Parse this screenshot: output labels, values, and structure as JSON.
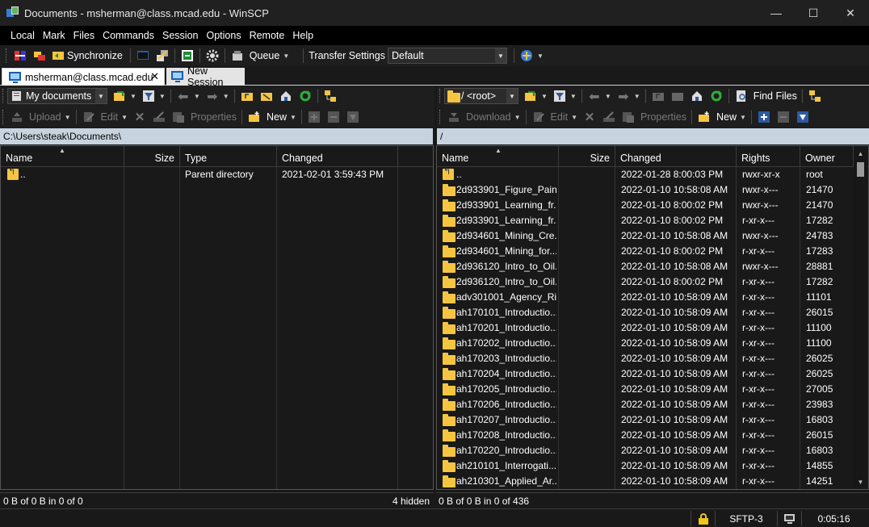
{
  "window": {
    "title": "Documents - msherman@class.mcad.edu - WinSCP",
    "controls": [
      "—",
      "☐",
      "✕"
    ]
  },
  "menu": [
    "Local",
    "Mark",
    "Files",
    "Commands",
    "Session",
    "Options",
    "Remote",
    "Help"
  ],
  "toolbar": {
    "synchronize": "Synchronize",
    "queue": "Queue",
    "transfer_settings": "Transfer Settings",
    "transfer_profile": "Default"
  },
  "tabs": {
    "active": "msherman@class.mcad.edu",
    "new_session": "New Session"
  },
  "local": {
    "location": "My documents",
    "upload": "Upload",
    "edit": "Edit",
    "properties": "Properties",
    "new": "New",
    "path": "C:\\Users\\steak\\Documents\\",
    "columns": [
      "Name",
      "Size",
      "Type",
      "Changed"
    ],
    "files": [
      {
        "name": "..",
        "size": "",
        "type": "Parent directory",
        "changed": "2021-02-01  3:59:43 PM"
      }
    ],
    "status": "0 B of 0 B in 0 of 0",
    "hidden": "4 hidden"
  },
  "remote": {
    "location": "/ <root>",
    "find_files": "Find Files",
    "download": "Download",
    "edit": "Edit",
    "properties": "Properties",
    "new": "New",
    "path": "/",
    "columns": [
      "Name",
      "Size",
      "Changed",
      "Rights",
      "Owner"
    ],
    "files": [
      {
        "name": "..",
        "changed": "2022-01-28 8:00:03 PM",
        "rights": "rwxr-xr-x",
        "owner": "root"
      },
      {
        "name": "2d933901_Figure_Pain...",
        "changed": "2022-01-10 10:58:08 AM",
        "rights": "rwxr-x---",
        "owner": "21470"
      },
      {
        "name": "2d933901_Learning_fr...",
        "changed": "2022-01-10 8:00:02 PM",
        "rights": "rwxr-x---",
        "owner": "21470"
      },
      {
        "name": "2d933901_Learning_fr...",
        "changed": "2022-01-10 8:00:02 PM",
        "rights": "r-xr-x---",
        "owner": "17282"
      },
      {
        "name": "2d934601_Mining_Cre...",
        "changed": "2022-01-10 10:58:08 AM",
        "rights": "rwxr-x---",
        "owner": "24783"
      },
      {
        "name": "2d934601_Mining_for...",
        "changed": "2022-01-10 8:00:02 PM",
        "rights": "r-xr-x---",
        "owner": "17283"
      },
      {
        "name": "2d936120_Intro_to_Oil...",
        "changed": "2022-01-10 10:58:08 AM",
        "rights": "rwxr-x---",
        "owner": "28881"
      },
      {
        "name": "2d936120_Intro_to_Oil...",
        "changed": "2022-01-10 8:00:02 PM",
        "rights": "r-xr-x---",
        "owner": "17282"
      },
      {
        "name": "adv301001_Agency_Ri...",
        "changed": "2022-01-10 10:58:09 AM",
        "rights": "r-xr-x---",
        "owner": "11101"
      },
      {
        "name": "ah170101_Introductio...",
        "changed": "2022-01-10 10:58:09 AM",
        "rights": "r-xr-x---",
        "owner": "26015"
      },
      {
        "name": "ah170201_Introductio...",
        "changed": "2022-01-10 10:58:09 AM",
        "rights": "r-xr-x---",
        "owner": "11100"
      },
      {
        "name": "ah170202_Introductio...",
        "changed": "2022-01-10 10:58:09 AM",
        "rights": "r-xr-x---",
        "owner": "11100"
      },
      {
        "name": "ah170203_Introductio...",
        "changed": "2022-01-10 10:58:09 AM",
        "rights": "r-xr-x---",
        "owner": "26025"
      },
      {
        "name": "ah170204_Introductio...",
        "changed": "2022-01-10 10:58:09 AM",
        "rights": "r-xr-x---",
        "owner": "26025"
      },
      {
        "name": "ah170205_Introductio...",
        "changed": "2022-01-10 10:58:09 AM",
        "rights": "r-xr-x---",
        "owner": "27005"
      },
      {
        "name": "ah170206_Introductio...",
        "changed": "2022-01-10 10:58:09 AM",
        "rights": "r-xr-x---",
        "owner": "23983"
      },
      {
        "name": "ah170207_Introductio...",
        "changed": "2022-01-10 10:58:09 AM",
        "rights": "r-xr-x---",
        "owner": "16803"
      },
      {
        "name": "ah170208_Introductio...",
        "changed": "2022-01-10 10:58:09 AM",
        "rights": "r-xr-x---",
        "owner": "26015"
      },
      {
        "name": "ah170220_Introductio...",
        "changed": "2022-01-10 10:58:09 AM",
        "rights": "r-xr-x---",
        "owner": "16803"
      },
      {
        "name": "ah210101_Interrogati...",
        "changed": "2022-01-10 10:58:09 AM",
        "rights": "r-xr-x---",
        "owner": "14855"
      },
      {
        "name": "ah210301_Applied_Ar...",
        "changed": "2022-01-10 10:58:09 AM",
        "rights": "r-xr-x---",
        "owner": "14251"
      }
    ],
    "status": "0 B of 0 B in 0 of 436"
  },
  "statusbar": {
    "protocol": "SFTP-3",
    "elapsed": "0:05:16"
  },
  "colors": {
    "path_bar": "#c7d3df",
    "folder": "#f5c542",
    "tab_active": "#ffffff",
    "lock": "#f0c419"
  }
}
